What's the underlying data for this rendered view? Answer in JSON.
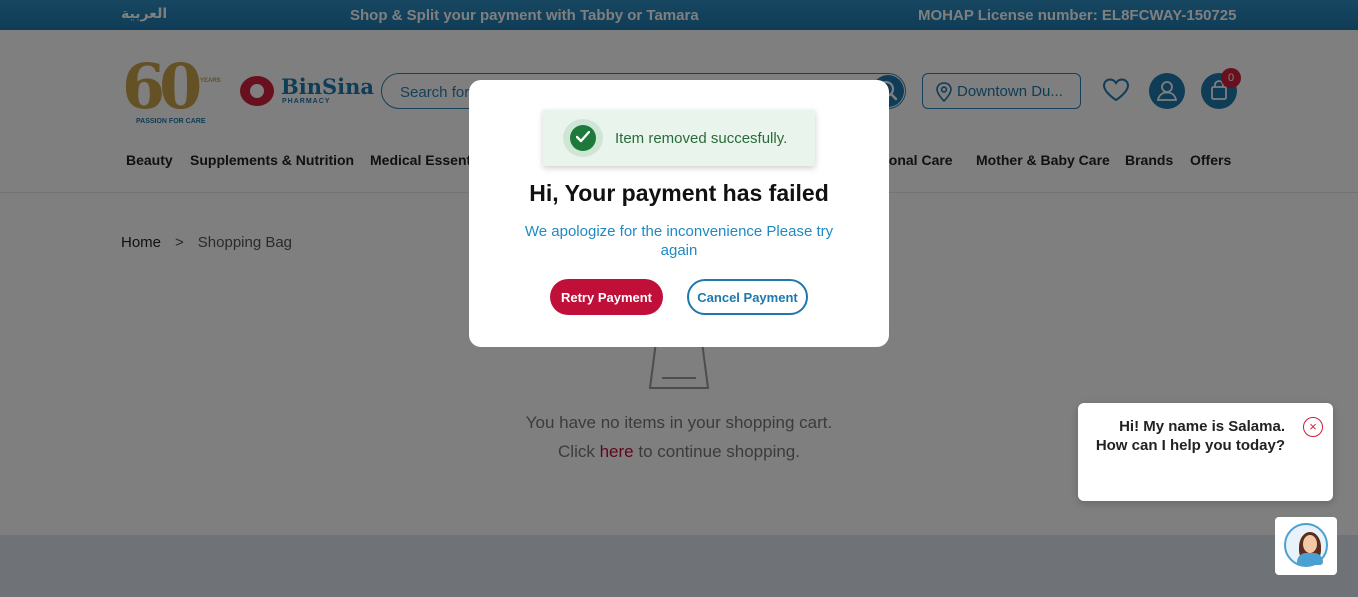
{
  "topbar": {
    "arabic_link": "العربية",
    "promo": "Shop & Split your payment with Tabby or Tamara",
    "license": "MOHAP License number: EL8FCWAY-150725"
  },
  "logo": {
    "sixty": "60",
    "years": "YEARS",
    "tagline": "PASSION FOR CARE",
    "brand_name": "BinSina",
    "brand_sub": "PHARMACY"
  },
  "search": {
    "placeholder": "Search for"
  },
  "location": {
    "label": "Downtown Du..."
  },
  "cart": {
    "count": "0"
  },
  "nav": {
    "items": [
      "Beauty",
      "Supplements & Nutrition",
      "Medical Essent",
      "sonal Care",
      "Mother & Baby Care",
      "Brands",
      "Offers"
    ]
  },
  "breadcrumb": {
    "home": "Home",
    "separator": ">",
    "current": "Shopping Bag"
  },
  "empty_cart": {
    "line1": "You have no items in your shopping cart.",
    "click": "Click",
    "here": "here",
    "continue": "to continue shopping."
  },
  "toast": {
    "message": "Item removed succesfully."
  },
  "modal": {
    "title": "Hi, Your payment has failed",
    "subtitle": "We apologize for the inconvenience Please try again",
    "retry_label": "Retry Payment",
    "cancel_label": "Cancel Payment"
  },
  "chat": {
    "greeting": "Hi! My name is Salama. How can I help you today?",
    "close_glyph": "×"
  },
  "colors": {
    "brand_blue": "#1f78ad",
    "accent_red": "#c0103a",
    "success_green": "#1e7a3a"
  }
}
